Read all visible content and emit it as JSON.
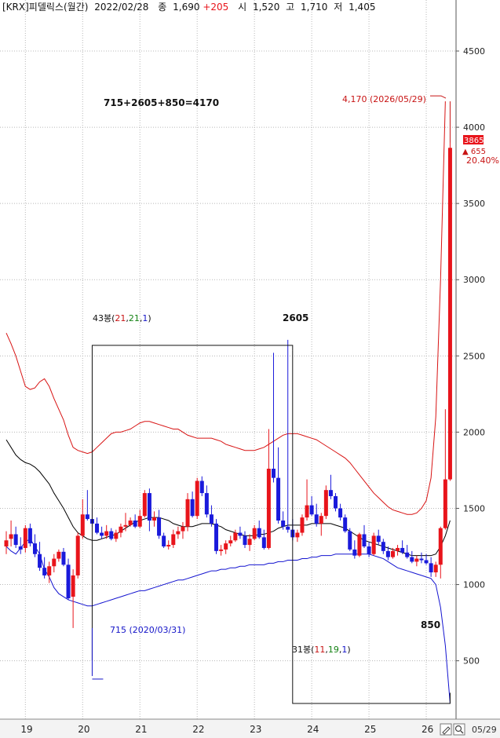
{
  "header": {
    "code": "[KRX]",
    "name": "피델릭스",
    "period": "(월간)",
    "date": "2022/02/28",
    "close_label": "종",
    "close_value": "1,690",
    "change": "+205",
    "open_label": "시",
    "open_value": "1,520",
    "high_label": "고",
    "high_value": "1,710",
    "low_label": "저",
    "low_value": "1,405"
  },
  "annotations": {
    "formula": "715+2605+850=4170",
    "target_label": "4,170 (2026/05/29)",
    "last_price": "3865",
    "last_change": "▲ 655",
    "last_pct": "20.40%",
    "low_label": "715 (2020/03/31)",
    "wave1_prefix": "43봉(",
    "wave1_a": "21",
    "wave1_b": "21",
    "wave1_c": "1",
    "wave1_suffix": ")",
    "wave1_value": "2605",
    "wave2_prefix": "31봉(",
    "wave2_a": "11",
    "wave2_b": "19",
    "wave2_c": "1",
    "wave2_suffix": ")",
    "wave2_value": "850"
  },
  "bottom": {
    "end_date": "05/29"
  },
  "colors": {
    "up": "#e8141b",
    "down": "#1a1adb",
    "band_upper": "#d81414",
    "band_lower": "#1414d0",
    "ma": "#000000",
    "grid": "#b8b8b8",
    "label_red": "#c81414",
    "label_blue": "#1414c8",
    "label_green": "#148214"
  },
  "chart_data": {
    "type": "candlestick",
    "ylim": [
      150,
      4850
    ],
    "yticks": [
      500,
      1000,
      1500,
      2000,
      2500,
      3000,
      3500,
      4000,
      4500
    ],
    "ytick_labels": [
      "500",
      "1000",
      "1500",
      "2000",
      "2500",
      "3000",
      "3500",
      "4000",
      "4500"
    ],
    "x_labels": [
      "19",
      "20",
      "21",
      "22",
      "23",
      "24",
      "25",
      "26"
    ],
    "first_year": 2019,
    "candles": [
      {
        "o": 1250,
        "h": 1350,
        "l": 1200,
        "c": 1290
      },
      {
        "o": 1300,
        "h": 1420,
        "l": 1250,
        "c": 1330
      },
      {
        "o": 1330,
        "h": 1380,
        "l": 1240,
        "c": 1260
      },
      {
        "o": 1250,
        "h": 1310,
        "l": 1200,
        "c": 1230
      },
      {
        "o": 1240,
        "h": 1390,
        "l": 1210,
        "c": 1370
      },
      {
        "o": 1370,
        "h": 1400,
        "l": 1250,
        "c": 1270
      },
      {
        "o": 1270,
        "h": 1330,
        "l": 1180,
        "c": 1200
      },
      {
        "o": 1200,
        "h": 1280,
        "l": 1090,
        "c": 1110
      },
      {
        "o": 1110,
        "h": 1180,
        "l": 1040,
        "c": 1060
      },
      {
        "o": 1060,
        "h": 1150,
        "l": 1010,
        "c": 1120
      },
      {
        "o": 1120,
        "h": 1200,
        "l": 1080,
        "c": 1170
      },
      {
        "o": 1170,
        "h": 1230,
        "l": 1150,
        "c": 1215
      },
      {
        "o": 1215,
        "h": 1240,
        "l": 1120,
        "c": 1130
      },
      {
        "o": 1130,
        "h": 1170,
        "l": 900,
        "c": 910
      },
      {
        "o": 920,
        "h": 1100,
        "l": 715,
        "c": 1060
      },
      {
        "o": 1060,
        "h": 1340,
        "l": 1040,
        "c": 1320
      },
      {
        "o": 1320,
        "h": 1560,
        "l": 1300,
        "c": 1460
      },
      {
        "o": 1460,
        "h": 1620,
        "l": 1420,
        "c": 1430
      },
      {
        "o": 1430,
        "h": 1500,
        "l": 1380,
        "c": 1400
      },
      {
        "o": 1400,
        "h": 1440,
        "l": 1330,
        "c": 1340
      },
      {
        "o": 1340,
        "h": 1380,
        "l": 1300,
        "c": 1320
      },
      {
        "o": 1320,
        "h": 1390,
        "l": 1300,
        "c": 1350
      },
      {
        "o": 1350,
        "h": 1370,
        "l": 1290,
        "c": 1300
      },
      {
        "o": 1300,
        "h": 1360,
        "l": 1280,
        "c": 1340
      },
      {
        "o": 1340,
        "h": 1400,
        "l": 1310,
        "c": 1380
      },
      {
        "o": 1380,
        "h": 1470,
        "l": 1350,
        "c": 1390
      },
      {
        "o": 1390,
        "h": 1440,
        "l": 1380,
        "c": 1420
      },
      {
        "o": 1420,
        "h": 1460,
        "l": 1370,
        "c": 1380
      },
      {
        "o": 1380,
        "h": 1490,
        "l": 1370,
        "c": 1450
      },
      {
        "o": 1450,
        "h": 1620,
        "l": 1440,
        "c": 1600
      },
      {
        "o": 1600,
        "h": 1630,
        "l": 1350,
        "c": 1420
      },
      {
        "o": 1420,
        "h": 1480,
        "l": 1380,
        "c": 1440
      },
      {
        "o": 1440,
        "h": 1490,
        "l": 1300,
        "c": 1320
      },
      {
        "o": 1320,
        "h": 1340,
        "l": 1240,
        "c": 1250
      },
      {
        "o": 1250,
        "h": 1290,
        "l": 1230,
        "c": 1260
      },
      {
        "o": 1260,
        "h": 1360,
        "l": 1240,
        "c": 1330
      },
      {
        "o": 1330,
        "h": 1380,
        "l": 1300,
        "c": 1350
      },
      {
        "o": 1350,
        "h": 1410,
        "l": 1300,
        "c": 1380
      },
      {
        "o": 1380,
        "h": 1600,
        "l": 1350,
        "c": 1560
      },
      {
        "o": 1560,
        "h": 1610,
        "l": 1440,
        "c": 1450
      },
      {
        "o": 1450,
        "h": 1700,
        "l": 1430,
        "c": 1680
      },
      {
        "o": 1680,
        "h": 1710,
        "l": 1580,
        "c": 1600
      },
      {
        "o": 1600,
        "h": 1650,
        "l": 1440,
        "c": 1460
      },
      {
        "o": 1460,
        "h": 1520,
        "l": 1380,
        "c": 1400
      },
      {
        "o": 1400,
        "h": 1430,
        "l": 1200,
        "c": 1220
      },
      {
        "o": 1220,
        "h": 1260,
        "l": 1190,
        "c": 1230
      },
      {
        "o": 1230,
        "h": 1290,
        "l": 1200,
        "c": 1270
      },
      {
        "o": 1270,
        "h": 1320,
        "l": 1250,
        "c": 1290
      },
      {
        "o": 1290,
        "h": 1360,
        "l": 1280,
        "c": 1340
      },
      {
        "o": 1340,
        "h": 1380,
        "l": 1300,
        "c": 1320
      },
      {
        "o": 1320,
        "h": 1350,
        "l": 1240,
        "c": 1260
      },
      {
        "o": 1260,
        "h": 1330,
        "l": 1220,
        "c": 1300
      },
      {
        "o": 1300,
        "h": 1390,
        "l": 1290,
        "c": 1370
      },
      {
        "o": 1370,
        "h": 1420,
        "l": 1300,
        "c": 1310
      },
      {
        "o": 1310,
        "h": 1360,
        "l": 1230,
        "c": 1240
      },
      {
        "o": 1240,
        "h": 2020,
        "l": 1230,
        "c": 1760
      },
      {
        "o": 1760,
        "h": 2520,
        "l": 1670,
        "c": 1700
      },
      {
        "o": 1700,
        "h": 1900,
        "l": 1400,
        "c": 1420
      },
      {
        "o": 1420,
        "h": 1480,
        "l": 1360,
        "c": 1380
      },
      {
        "o": 1380,
        "h": 2605,
        "l": 1340,
        "c": 1360
      },
      {
        "o": 1360,
        "h": 1430,
        "l": 1290,
        "c": 1310
      },
      {
        "o": 1310,
        "h": 1360,
        "l": 1280,
        "c": 1340
      },
      {
        "o": 1340,
        "h": 1460,
        "l": 1320,
        "c": 1440
      },
      {
        "o": 1440,
        "h": 1690,
        "l": 1420,
        "c": 1520
      },
      {
        "o": 1520,
        "h": 1580,
        "l": 1450,
        "c": 1460
      },
      {
        "o": 1460,
        "h": 1530,
        "l": 1380,
        "c": 1400
      },
      {
        "o": 1400,
        "h": 1470,
        "l": 1320,
        "c": 1450
      },
      {
        "o": 1450,
        "h": 1650,
        "l": 1430,
        "c": 1620
      },
      {
        "o": 1620,
        "h": 1720,
        "l": 1560,
        "c": 1580
      },
      {
        "o": 1580,
        "h": 1600,
        "l": 1480,
        "c": 1500
      },
      {
        "o": 1500,
        "h": 1530,
        "l": 1420,
        "c": 1440
      },
      {
        "o": 1440,
        "h": 1460,
        "l": 1340,
        "c": 1350
      },
      {
        "o": 1350,
        "h": 1370,
        "l": 1220,
        "c": 1230
      },
      {
        "o": 1230,
        "h": 1290,
        "l": 1170,
        "c": 1190
      },
      {
        "o": 1190,
        "h": 1340,
        "l": 1180,
        "c": 1330
      },
      {
        "o": 1330,
        "h": 1390,
        "l": 1240,
        "c": 1250
      },
      {
        "o": 1250,
        "h": 1280,
        "l": 1180,
        "c": 1200
      },
      {
        "o": 1200,
        "h": 1340,
        "l": 1190,
        "c": 1320
      },
      {
        "o": 1320,
        "h": 1360,
        "l": 1260,
        "c": 1280
      },
      {
        "o": 1280,
        "h": 1300,
        "l": 1200,
        "c": 1220
      },
      {
        "o": 1220,
        "h": 1250,
        "l": 1160,
        "c": 1180
      },
      {
        "o": 1180,
        "h": 1240,
        "l": 1170,
        "c": 1220
      },
      {
        "o": 1220,
        "h": 1260,
        "l": 1190,
        "c": 1240
      },
      {
        "o": 1240,
        "h": 1290,
        "l": 1200,
        "c": 1210
      },
      {
        "o": 1210,
        "h": 1260,
        "l": 1170,
        "c": 1180
      },
      {
        "o": 1180,
        "h": 1220,
        "l": 1140,
        "c": 1150
      },
      {
        "o": 1150,
        "h": 1190,
        "l": 1120,
        "c": 1170
      },
      {
        "o": 1170,
        "h": 1210,
        "l": 1140,
        "c": 1160
      },
      {
        "o": 1160,
        "h": 1200,
        "l": 1130,
        "c": 1140
      },
      {
        "o": 1140,
        "h": 1180,
        "l": 1050,
        "c": 1080
      },
      {
        "o": 1080,
        "h": 1150,
        "l": 1050,
        "c": 1130
      },
      {
        "o": 1130,
        "h": 1380,
        "l": 1040,
        "c": 1370
      },
      {
        "o": 1370,
        "h": 2150,
        "l": 1360,
        "c": 1690
      },
      {
        "o": 1690,
        "h": 3900,
        "l": 1680,
        "c": 3865
      }
    ],
    "ma": [
      1950,
      1900,
      1850,
      1820,
      1800,
      1790,
      1770,
      1740,
      1700,
      1660,
      1600,
      1550,
      1500,
      1440,
      1380,
      1340,
      1320,
      1300,
      1290,
      1290,
      1300,
      1310,
      1320,
      1330,
      1350,
      1370,
      1390,
      1410,
      1420,
      1430,
      1440,
      1440,
      1440,
      1430,
      1420,
      1400,
      1390,
      1380,
      1380,
      1380,
      1390,
      1400,
      1400,
      1400,
      1390,
      1380,
      1360,
      1350,
      1340,
      1330,
      1320,
      1320,
      1320,
      1330,
      1330,
      1340,
      1350,
      1370,
      1380,
      1390,
      1390,
      1390,
      1390,
      1390,
      1400,
      1400,
      1400,
      1400,
      1400,
      1390,
      1380,
      1370,
      1350,
      1330,
      1310,
      1290,
      1280,
      1270,
      1260,
      1250,
      1240,
      1230,
      1220,
      1210,
      1200,
      1190,
      1190,
      1190,
      1190,
      1190,
      1200,
      1250,
      1320,
      1420
    ],
    "upper": [
      2650,
      2580,
      2500,
      2400,
      2300,
      2280,
      2290,
      2330,
      2350,
      2300,
      2220,
      2150,
      2080,
      1980,
      1900,
      1880,
      1870,
      1860,
      1870,
      1900,
      1930,
      1960,
      1990,
      2000,
      2000,
      2010,
      2020,
      2040,
      2060,
      2070,
      2070,
      2060,
      2050,
      2040,
      2030,
      2020,
      2020,
      2000,
      1980,
      1970,
      1960,
      1960,
      1960,
      1960,
      1950,
      1940,
      1920,
      1910,
      1900,
      1890,
      1880,
      1880,
      1880,
      1890,
      1900,
      1920,
      1940,
      1960,
      1980,
      1990,
      1990,
      1990,
      1980,
      1970,
      1960,
      1950,
      1930,
      1910,
      1890,
      1870,
      1850,
      1830,
      1800,
      1760,
      1720,
      1680,
      1640,
      1600,
      1570,
      1540,
      1510,
      1490,
      1480,
      1470,
      1460,
      1460,
      1470,
      1500,
      1550,
      1700,
      2100,
      3000,
      4170
    ],
    "lower": [
      1250,
      1220,
      1200,
      1240,
      1280,
      1300,
      1250,
      1200,
      1100,
      1050,
      980,
      940,
      920,
      900,
      890,
      880,
      870,
      860,
      860,
      870,
      880,
      890,
      900,
      910,
      920,
      930,
      940,
      950,
      960,
      960,
      970,
      980,
      990,
      1000,
      1010,
      1020,
      1030,
      1030,
      1040,
      1050,
      1060,
      1070,
      1080,
      1090,
      1090,
      1100,
      1100,
      1110,
      1110,
      1120,
      1120,
      1130,
      1130,
      1130,
      1130,
      1140,
      1140,
      1150,
      1150,
      1160,
      1160,
      1160,
      1170,
      1170,
      1180,
      1180,
      1190,
      1190,
      1190,
      1200,
      1200,
      1200,
      1200,
      1200,
      1200,
      1200,
      1200,
      1190,
      1180,
      1170,
      1150,
      1130,
      1110,
      1100,
      1090,
      1080,
      1070,
      1060,
      1050,
      1040,
      1000,
      850,
      600,
      220
    ],
    "low_point_value": 715,
    "low_point_date": "2020/03/31",
    "wave1": {
      "bars": 43,
      "value": 2605
    },
    "wave2": {
      "bars": 31,
      "value": 850
    },
    "target": {
      "value": 4170,
      "date": "2026/05/29"
    }
  }
}
